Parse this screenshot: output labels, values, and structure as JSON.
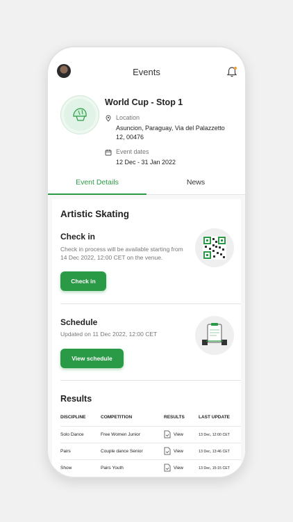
{
  "header": {
    "title": "Events"
  },
  "event": {
    "name": "World Cup - Stop 1",
    "location_label": "Location",
    "location_value": "Asuncion, Paraguay, Via del Palazzetto 12, 00476",
    "dates_label": "Event dates",
    "dates_value": "12 Dec - 31 Jan 2022"
  },
  "tabs": [
    {
      "label": "Event Details",
      "active": true
    },
    {
      "label": "News",
      "active": false
    }
  ],
  "section": {
    "title": "Artistic Skating"
  },
  "checkin": {
    "title": "Check in",
    "text": "Check in process will be available starting from 14 Dec 2022, 12:00 CET on the venue.",
    "button": "Check in"
  },
  "schedule": {
    "title": "Schedule",
    "text": "Updated on 11 Dec 2022, 12:00 CET",
    "button": "View schedule"
  },
  "results": {
    "title": "Results",
    "columns": [
      "DISCIPLINE",
      "COMPETITION",
      "RESULTS",
      "LAST UPDATE"
    ],
    "rows": [
      {
        "discipline": "Solo Dance",
        "competition": "Free Women Junior",
        "result": "View",
        "updated": "13 Dec, 12:00 CET"
      },
      {
        "discipline": "Pairs",
        "competition": "Couple dance Senior",
        "result": "View",
        "updated": "13 Dec, 13:46 CET"
      },
      {
        "discipline": "Show",
        "competition": "Pairs Youth",
        "result": "View",
        "updated": "13 Dec, 15:15 CET"
      }
    ]
  },
  "colors": {
    "accent": "#2b9a46",
    "notification_dot": "#f0a040"
  },
  "icons": {
    "avatar": "user-avatar",
    "bell": "bell-icon",
    "location": "location-pin-icon",
    "calendar": "calendar-icon",
    "event_logo": "helmet-icon",
    "qr": "qr-code-icon",
    "schedule": "clipboard-icon",
    "view": "document-icon"
  }
}
